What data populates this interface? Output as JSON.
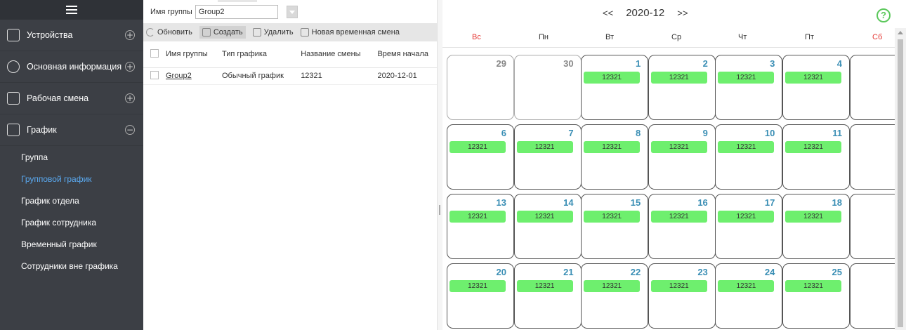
{
  "sidebar": {
    "sections": [
      {
        "label": "Устройства",
        "icon": "device-icon",
        "toggle": "+"
      },
      {
        "label": "Основная информация",
        "icon": "info-icon",
        "toggle": "+"
      },
      {
        "label": "Рабочая смена",
        "icon": "shift-icon",
        "toggle": "+"
      },
      {
        "label": "График",
        "icon": "schedule-icon",
        "toggle": "−"
      }
    ],
    "subitems": [
      {
        "label": "Группа",
        "active": false
      },
      {
        "label": "Групповой график",
        "active": true
      },
      {
        "label": "График отдела",
        "active": false
      },
      {
        "label": "График сотрудника",
        "active": false
      },
      {
        "label": "Временный график",
        "active": false
      },
      {
        "label": "Сотрудники вне графика",
        "active": false
      }
    ]
  },
  "filter": {
    "label": "Имя группы",
    "value": "Group2"
  },
  "toolbar": {
    "refresh": "Обновить",
    "create": "Создать",
    "delete": "Удалить",
    "temp_shift": "Новая временная смена"
  },
  "table": {
    "headers": [
      "Имя группы",
      "Тип графика",
      "Название смены",
      "Время начала"
    ],
    "rows": [
      [
        "Group2",
        "Обычный график",
        "12321",
        "2020-12-01"
      ]
    ]
  },
  "calendar": {
    "prev": "<<",
    "next": ">>",
    "month": "2020-12",
    "help": "?",
    "weekdays": [
      "Вс",
      "Пн",
      "Вт",
      "Ср",
      "Чт",
      "Пт",
      "Сб"
    ],
    "weekend_color": "#e53935",
    "shift_color": "#6eef6e",
    "weeks": [
      [
        {
          "d": "29",
          "prev": true
        },
        {
          "d": "30",
          "prev": true
        },
        {
          "d": "1",
          "s": "12321"
        },
        {
          "d": "2",
          "s": "12321"
        },
        {
          "d": "3",
          "s": "12321"
        },
        {
          "d": "4",
          "s": "12321"
        },
        {
          "d": ""
        }
      ],
      [
        {
          "d": "6",
          "s": "12321"
        },
        {
          "d": "7",
          "s": "12321"
        },
        {
          "d": "8",
          "s": "12321"
        },
        {
          "d": "9",
          "s": "12321"
        },
        {
          "d": "10",
          "s": "12321"
        },
        {
          "d": "11",
          "s": "12321"
        },
        {
          "d": ""
        }
      ],
      [
        {
          "d": "13",
          "s": "12321"
        },
        {
          "d": "14",
          "s": "12321"
        },
        {
          "d": "15",
          "s": "12321"
        },
        {
          "d": "16",
          "s": "12321"
        },
        {
          "d": "17",
          "s": "12321"
        },
        {
          "d": "18",
          "s": "12321"
        },
        {
          "d": ""
        }
      ],
      [
        {
          "d": "20",
          "s": "12321"
        },
        {
          "d": "21",
          "s": "12321"
        },
        {
          "d": "22",
          "s": "12321"
        },
        {
          "d": "23",
          "s": "12321"
        },
        {
          "d": "24",
          "s": "12321"
        },
        {
          "d": "25",
          "s": "12321"
        },
        {
          "d": ""
        }
      ]
    ]
  }
}
